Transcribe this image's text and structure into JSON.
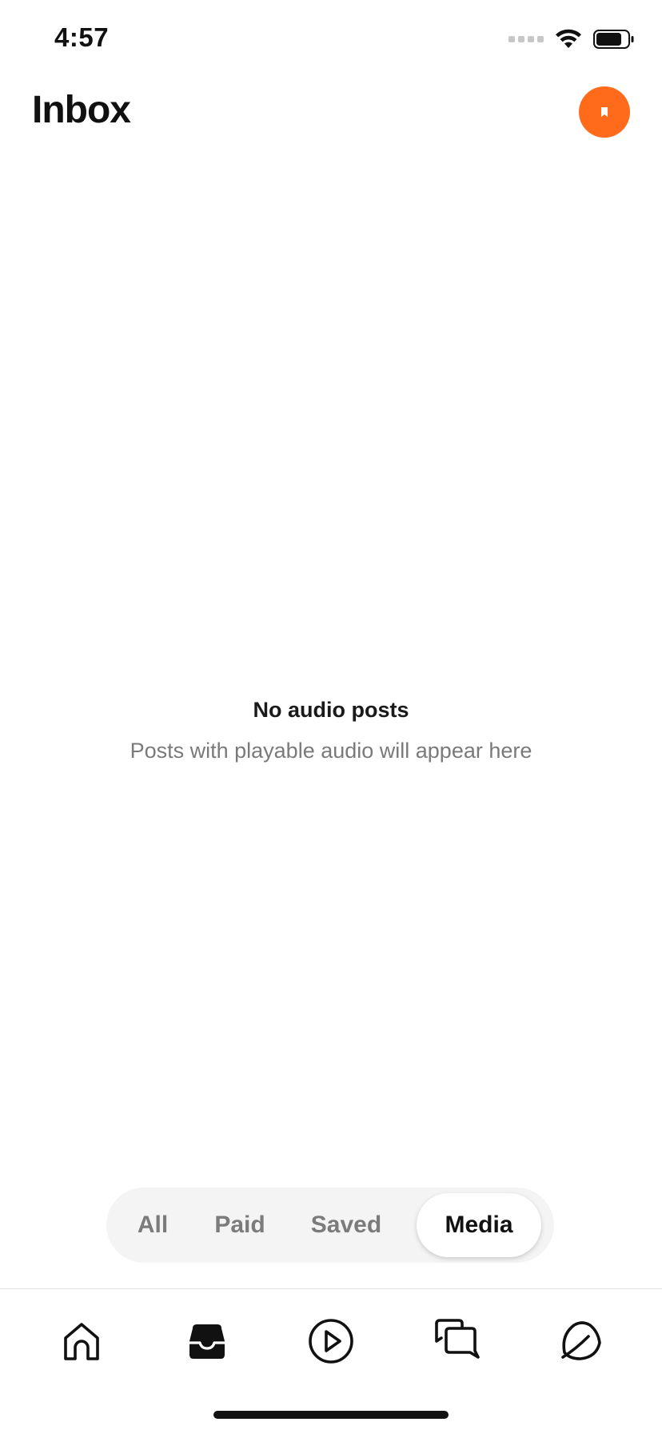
{
  "status_bar": {
    "time": "4:57"
  },
  "header": {
    "title": "Inbox",
    "avatar_color": "#ff6b1a"
  },
  "empty_state": {
    "title": "No audio posts",
    "subtitle": "Posts with playable audio will appear here"
  },
  "filters": {
    "tabs": [
      {
        "label": "All",
        "selected": false
      },
      {
        "label": "Paid",
        "selected": false
      },
      {
        "label": "Saved",
        "selected": false
      },
      {
        "label": "Media",
        "selected": true
      }
    ]
  },
  "bottom_nav": {
    "items": [
      {
        "icon": "home-icon",
        "active": false
      },
      {
        "icon": "inbox-icon",
        "active": true
      },
      {
        "icon": "play-icon",
        "active": false
      },
      {
        "icon": "chat-icon",
        "active": false
      },
      {
        "icon": "profile-leaf-icon",
        "active": false
      }
    ]
  }
}
